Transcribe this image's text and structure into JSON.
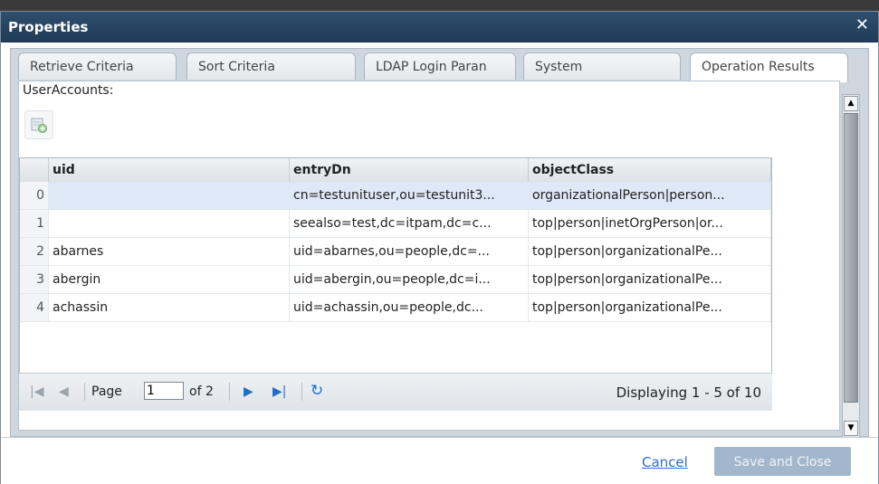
{
  "dialog": {
    "title": "Properties",
    "close_glyph": "✕"
  },
  "tabs": [
    {
      "label": "Retrieve Criteria"
    },
    {
      "label": "Sort Criteria"
    },
    {
      "label": "LDAP Login Paran"
    },
    {
      "label": "System"
    },
    {
      "label": "Operation Results",
      "active": true
    }
  ],
  "section": {
    "label": "UserAccounts:"
  },
  "grid": {
    "columns": [
      "uid",
      "entryDn",
      "objectClass"
    ],
    "rows": [
      {
        "num": "0",
        "uid": "",
        "entryDn": "cn=testunituser,ou=testunit3...",
        "objectClass": "organizationalPerson|person..."
      },
      {
        "num": "1",
        "uid": "",
        "entryDn": "seealso=test,dc=itpam,dc=c...",
        "objectClass": "top|person|inetOrgPerson|or..."
      },
      {
        "num": "2",
        "uid": "abarnes",
        "entryDn": "uid=abarnes,ou=people,dc=...",
        "objectClass": "top|person|organizationalPe..."
      },
      {
        "num": "3",
        "uid": "abergin",
        "entryDn": "uid=abergin,ou=people,dc=i...",
        "objectClass": "top|person|organizationalPe..."
      },
      {
        "num": "4",
        "uid": "achassin",
        "entryDn": "uid=achassin,ou=people,dc...",
        "objectClass": "top|person|organizationalPe..."
      }
    ]
  },
  "pager": {
    "page_label": "Page",
    "page_value": "1",
    "of_label": "of 2",
    "display_text": "Displaying 1 - 5 of 10"
  },
  "footer": {
    "cancel_label": "Cancel",
    "save_label": "Save and Close"
  }
}
